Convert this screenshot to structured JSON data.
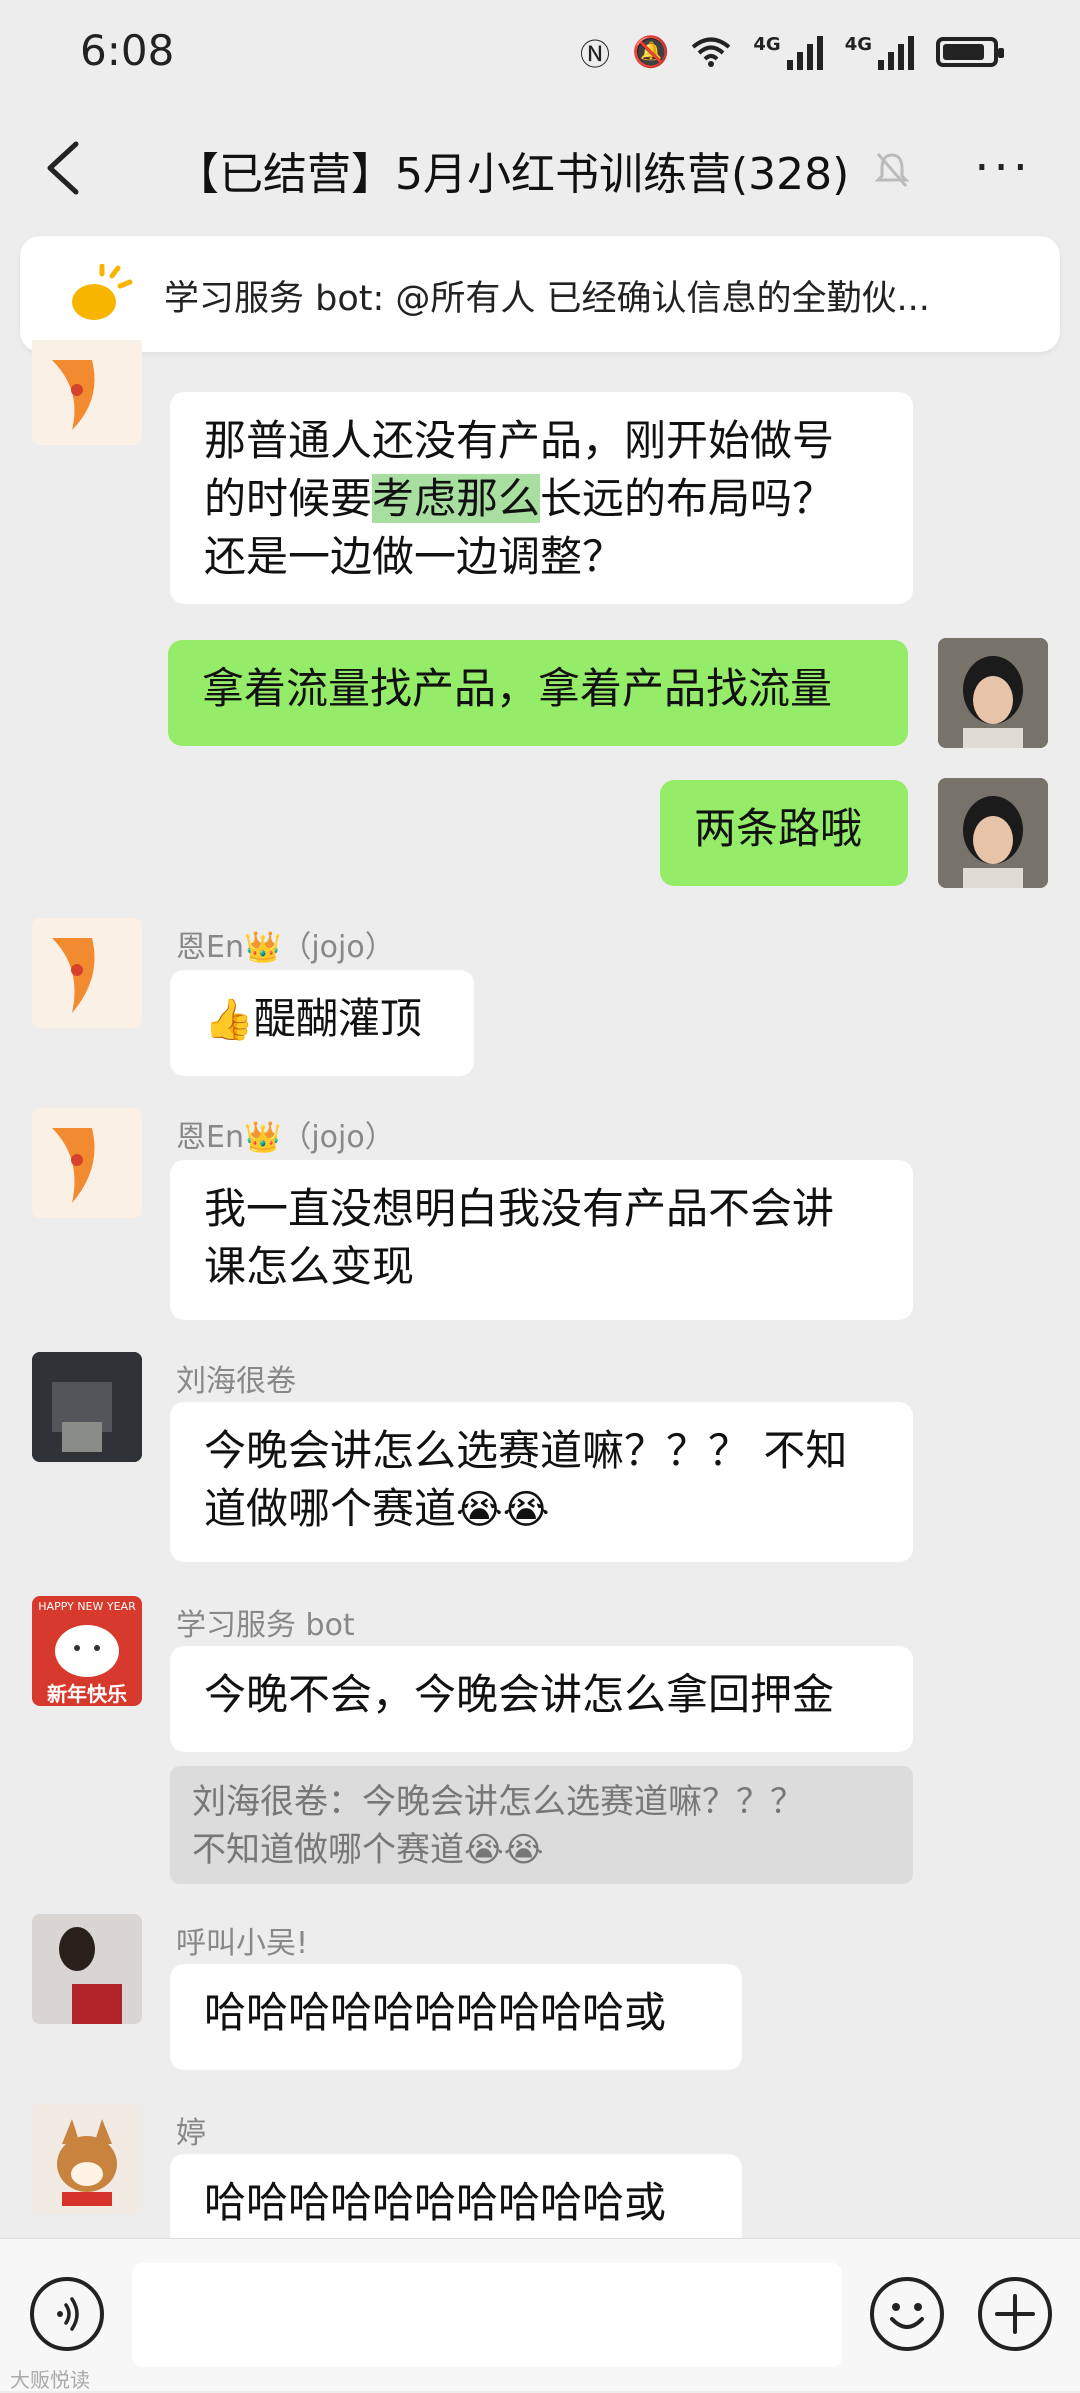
{
  "status_bar": {
    "time": "6:08",
    "net1": "4G",
    "net2": "4G",
    "battery_level": 0.85
  },
  "header": {
    "title": "【已结营】5月小红书训练营(328)",
    "more": "···"
  },
  "announcement": {
    "text": "学习服务 bot: @所有人 已经确认信息的全勤伙..."
  },
  "messages": {
    "m1": {
      "line1": "那普通人还没有产品，刚开始做号",
      "line2a": "的时候要",
      "line2hl": "考虑那么",
      "line2b": "长远的布局吗？",
      "line3": "还是一边做一边调整？"
    },
    "m2": {
      "text": "拿着流量找产品，拿着产品找流量"
    },
    "m3": {
      "text": "两条路哦"
    },
    "m4": {
      "sender": "恩En👑（jojo）",
      "emoji": "👍",
      "text": "醍醐灌顶"
    },
    "m5": {
      "sender": "恩En👑（jojo）",
      "line1": "我一直没想明白我没有产品不会讲",
      "line2": "课怎么变现"
    },
    "m6": {
      "sender": "刘海很卷",
      "line1": "今晚会讲怎么选赛道嘛？？？ 不知",
      "line2": "道做哪个赛道",
      "emoji": "😭😭"
    },
    "m7": {
      "sender": "学习服务 bot",
      "text": "今晚不会，今晚会讲怎么拿回押金",
      "quote_line1": "刘海很卷：今晚会讲怎么选赛道嘛？？？",
      "quote_line2": "不知道做哪个赛道",
      "quote_emoji": "😭😭"
    },
    "m8": {
      "sender": "呼叫小吴!",
      "text": "哈哈哈哈哈哈哈哈哈哈或"
    },
    "m9": {
      "sender": "婷",
      "text": "哈哈哈哈哈哈哈哈哈哈或"
    }
  },
  "bot_avatar": {
    "line1": "HAPPY NEW YEAR",
    "line2": "新年快乐"
  },
  "watermark": "大贩悦读",
  "colors": {
    "background": "#ededed",
    "my_bubble": "#95ec69",
    "other_bubble": "#ffffff",
    "highlight": "#a8dfa0"
  }
}
